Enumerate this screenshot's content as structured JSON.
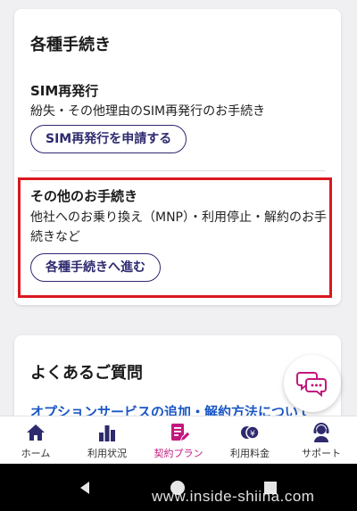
{
  "procedures_card": {
    "title": "各種手続き",
    "sim_reissue": {
      "title": "SIM再発行",
      "description": "紛失・その他理由のSIM再発行のお手続き",
      "button_label": "SIM再発行を申請する"
    },
    "other": {
      "title": "その他のお手続き",
      "description": "他社へのお乗り換え（MNP）・利用停止・解約のお手続きなど",
      "button_label": "各種手続きへ進む"
    }
  },
  "faq_card": {
    "title": "よくあるご質問",
    "first_link": "オプションサービスの追加・解約方法について"
  },
  "bottom_nav": {
    "items": [
      {
        "label": "ホーム",
        "icon": "home-icon"
      },
      {
        "label": "利用状況",
        "icon": "usage-chart-icon"
      },
      {
        "label": "契約プラン",
        "icon": "contract-plan-icon",
        "active": true
      },
      {
        "label": "利用料金",
        "icon": "billing-icon"
      },
      {
        "label": "サポート",
        "icon": "support-icon"
      }
    ]
  },
  "watermark": "www.inside-shiina.com",
  "colors": {
    "primary": "#2d2a6e",
    "active": "#c2187e",
    "link": "#1a56c4",
    "highlight": "#d9181e"
  }
}
